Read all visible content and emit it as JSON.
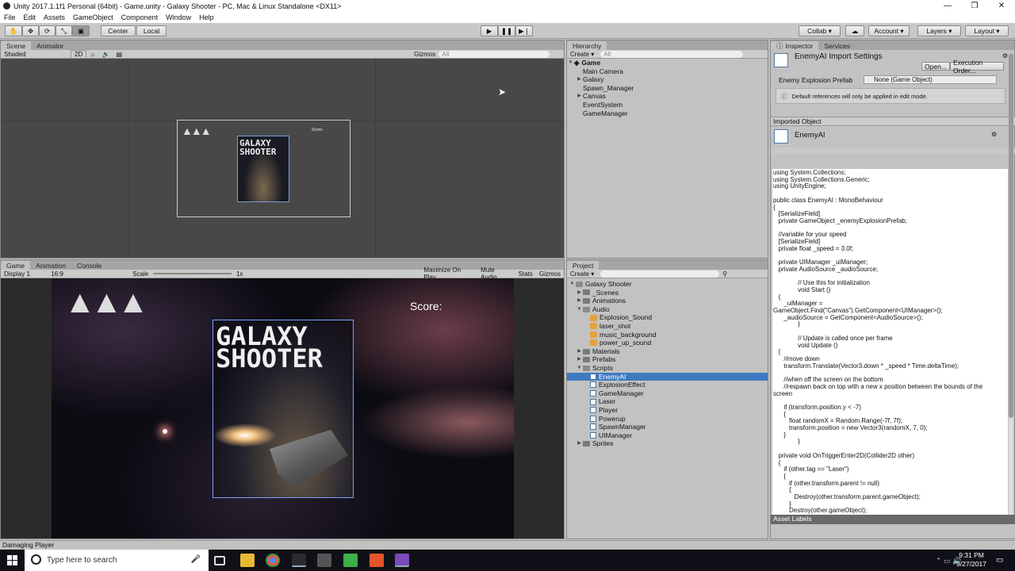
{
  "window": {
    "title": "Unity 2017.1.1f1 Personal (64bit) - Game.unity - Galaxy Shooter - PC, Mac & Linux Standalone <DX11>",
    "controls": [
      "—",
      "❐",
      "✕"
    ]
  },
  "menu": [
    "File",
    "Edit",
    "Assets",
    "GameObject",
    "Component",
    "Window",
    "Help"
  ],
  "toolbar": {
    "pivot": "Center",
    "space": "Local",
    "collab": "Collab ▾",
    "account": "Account",
    "layers": "Layers",
    "layout": "Layout"
  },
  "scene": {
    "tabs": [
      "Scene",
      "Animator"
    ],
    "shading": "Shaded",
    "mode2d": "2D",
    "gizmos": "Gizmos",
    "search": "All",
    "score_small": "Score:"
  },
  "game": {
    "tabs": [
      "Game",
      "Animation",
      "Console"
    ],
    "display": "Display 1",
    "aspect": "16:9",
    "scale_label": "Scale",
    "scale_value": "1x",
    "maximize": "Maximize On Play",
    "mute": "Mute Audio",
    "stats": "Stats",
    "gizmos": "Gizmos",
    "score": "Score:",
    "title_line1": "GALAXY",
    "title_line2": "SHOOTER"
  },
  "hierarchy": {
    "tab": "Hierarchy",
    "create": "Create ▾",
    "search": "All",
    "scene": "Game",
    "items": [
      "Main Camera",
      "Galaxy",
      "Spawn_Manager",
      "Canvas",
      "EventSystem",
      "GameManager"
    ]
  },
  "project": {
    "tab": "Project",
    "create": "Create ▾",
    "root": "Galaxy Shooter",
    "folders1": [
      "_Scenes",
      "Animations",
      "Audio"
    ],
    "audio": [
      "Explosion_Sound",
      "laser_shot",
      "music_background",
      "power_up_sound"
    ],
    "folders2": [
      "Materials",
      "Prefabs",
      "Scripts"
    ],
    "scripts": [
      "EnemyAI",
      "ExplosionEffect",
      "GameManager",
      "Laser",
      "Player",
      "Powerup",
      "SpawnManager",
      "UIManager"
    ],
    "last": "Sprites"
  },
  "inspector": {
    "tabs": [
      "Inspector",
      "Services"
    ],
    "title": "EnemyAI Import Settings",
    "open": "Open...",
    "exec": "Execution Order...",
    "field_label": "Enemy Explosion Prefab",
    "field_value": "None (Game Object)",
    "info": "Default references will only be applied in edit mode.",
    "imported": "Imported Object",
    "object": "EnemyAI",
    "asset_labels": "Asset Labels"
  },
  "code": "using System.Collections;\nusing System.Collections.Generic;\nusing UnityEngine;\n\npublic class EnemyAI : MonoBehaviour\n{\n   [SerializeField]\n   private GameObject _enemyExplosionPrefab;\n\n   //variable for your speed\n   [SerializeField]\n   private float _speed = 3.0f;\n\n   private UIManager _uiManager;\n   private AudioSource _audioSource;\n\n              // Use this for initialization\n              void Start ()\n   {\n      _uiManager =\nGameObject.Find(\"Canvas\").GetComponent<UIManager>();\n      _audioSource = GetComponent<AudioSource>();\n              }\n\n              // Update is called once per frame\n              void Update ()\n   {\n      //move down\n      transform.Translate(Vector3.down * _speed * Time.deltaTime);\n\n      //when off the screen on the bottom\n      //respawn back on top with a new x position between the bounds of the\nscreen\n\n      if (transform.position.y < -7)\n      {\n         float randomX = Random.Range(-7f, 7f);\n         transform.position = new Vector3(randomX, 7, 0);\n      }\n              }\n\n   private void OnTriggerEnter2D(Collider2D other)\n   {\n      if (other.tag == \"Laser\")\n      {\n         if (other.transform.parent != null)\n         {\n            Destroy(other.transform.parent.gameObject);\n         }\n         Destroy(other.gameObject);\n         Instantiate(_enemyExplosionPrefab, transform.position,\nQuaternion.identity);\n         _uiManager.UpdateScore();",
  "status": "Damaging Player",
  "taskbar": {
    "search": "Type here to search",
    "time": "9:31 PM",
    "date": "9/27/2017"
  },
  "colors": {
    "selection": "#3e7ac0",
    "panel": "#c2c2c2",
    "taskbar": "#101118"
  }
}
